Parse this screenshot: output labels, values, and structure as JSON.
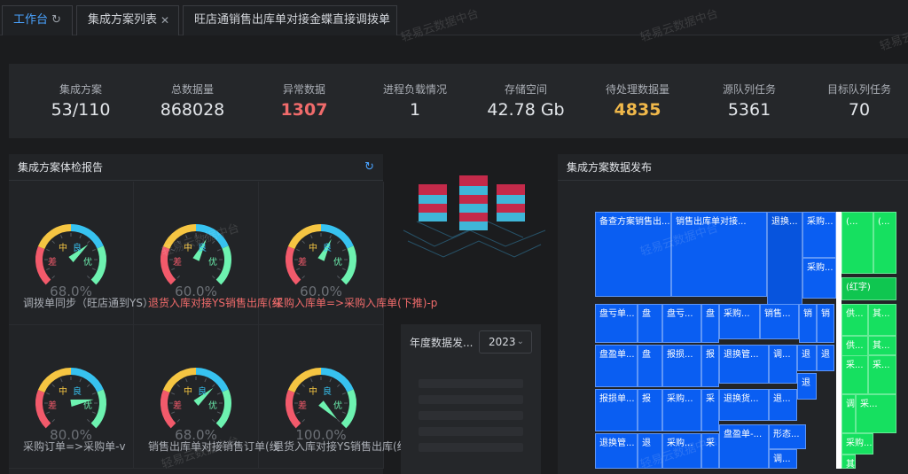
{
  "tabs": [
    {
      "label": "工作台",
      "active": true,
      "icon": "refresh-icon"
    },
    {
      "label": "集成方案列表",
      "closable": true
    },
    {
      "label": "旺店通销售出库单对接金蝶直接调拨单",
      "closable": true
    }
  ],
  "watermark": "轻易云数据中台",
  "stats": [
    {
      "label": "集成方案",
      "value": "53/110",
      "color": "#e3e6ea"
    },
    {
      "label": "总数据量",
      "value": "868028",
      "color": "#e3e6ea"
    },
    {
      "label": "异常数据",
      "value": "1307",
      "color": "#f06b6b"
    },
    {
      "label": "进程负载情况",
      "value": "1",
      "color": "#e3e6ea"
    },
    {
      "label": "存储空间",
      "value": "42.78 Gb",
      "color": "#e3e6ea"
    },
    {
      "label": "待处理数据量",
      "value": "4835",
      "color": "#f0b84a"
    },
    {
      "label": "源队列任务",
      "value": "5361",
      "color": "#e3e6ea"
    },
    {
      "label": "目标队列任务",
      "value": "70",
      "color": "#e3e6ea"
    }
  ],
  "health": {
    "title": "集成方案体检报告",
    "gauge_labels": {
      "good": "良",
      "mid": "中",
      "excellent": "优",
      "bad": "差"
    },
    "gauges": [
      {
        "percent": "68.0%",
        "value": 0.68,
        "label": "调拨单同步（旺店通到YS）",
        "label_color": "#a9adb4"
      },
      {
        "percent": "60.0%",
        "value": 0.6,
        "label": "退货入库对接YS销售出库(红",
        "label_color": "#f06b6b"
      },
      {
        "percent": "60.0%",
        "value": 0.6,
        "label": "采购入库单=>采购入库单(下推)-p",
        "label_color": "#f06b6b"
      },
      {
        "percent": "80.0%",
        "value": 0.8,
        "label": "采购订单=>采购单-v",
        "label_color": "#a9adb4"
      },
      {
        "percent": "68.0%",
        "value": 0.68,
        "label": "销售出库单对接销售订单(线",
        "label_color": "#a9adb4"
      },
      {
        "percent": "100.0%",
        "value": 1.0,
        "label": "退货入库对接YS销售出库(红",
        "label_color": "#a9adb4"
      }
    ]
  },
  "annual": {
    "title": "年度数据发...",
    "year": "2023"
  },
  "distribution": {
    "title": "集成方案数据发布",
    "cells": [
      "备查方案销售出...",
      "销售出库单对接...",
      "退换...",
      "采购...",
      "采购...",
      "盘亏单...",
      "盘",
      "盘亏...",
      "盘",
      "采购...",
      "销售...",
      "销",
      "销",
      "盘盈单...",
      "盘",
      "报损...",
      "报",
      "退换管...",
      "调...",
      "退",
      "退",
      "报损单...",
      "报",
      "采购...",
      "采",
      "退换货...",
      "退",
      "退...",
      "退换管...",
      "退",
      "采购...",
      "采",
      "盘盈单-...",
      "形态...",
      "调...",
      "(...",
      "(...",
      "(红字)",
      "供...",
      "其...",
      "供...",
      "其...",
      "采...",
      "采...",
      "调",
      "采...",
      "采购...",
      "其"
    ]
  }
}
